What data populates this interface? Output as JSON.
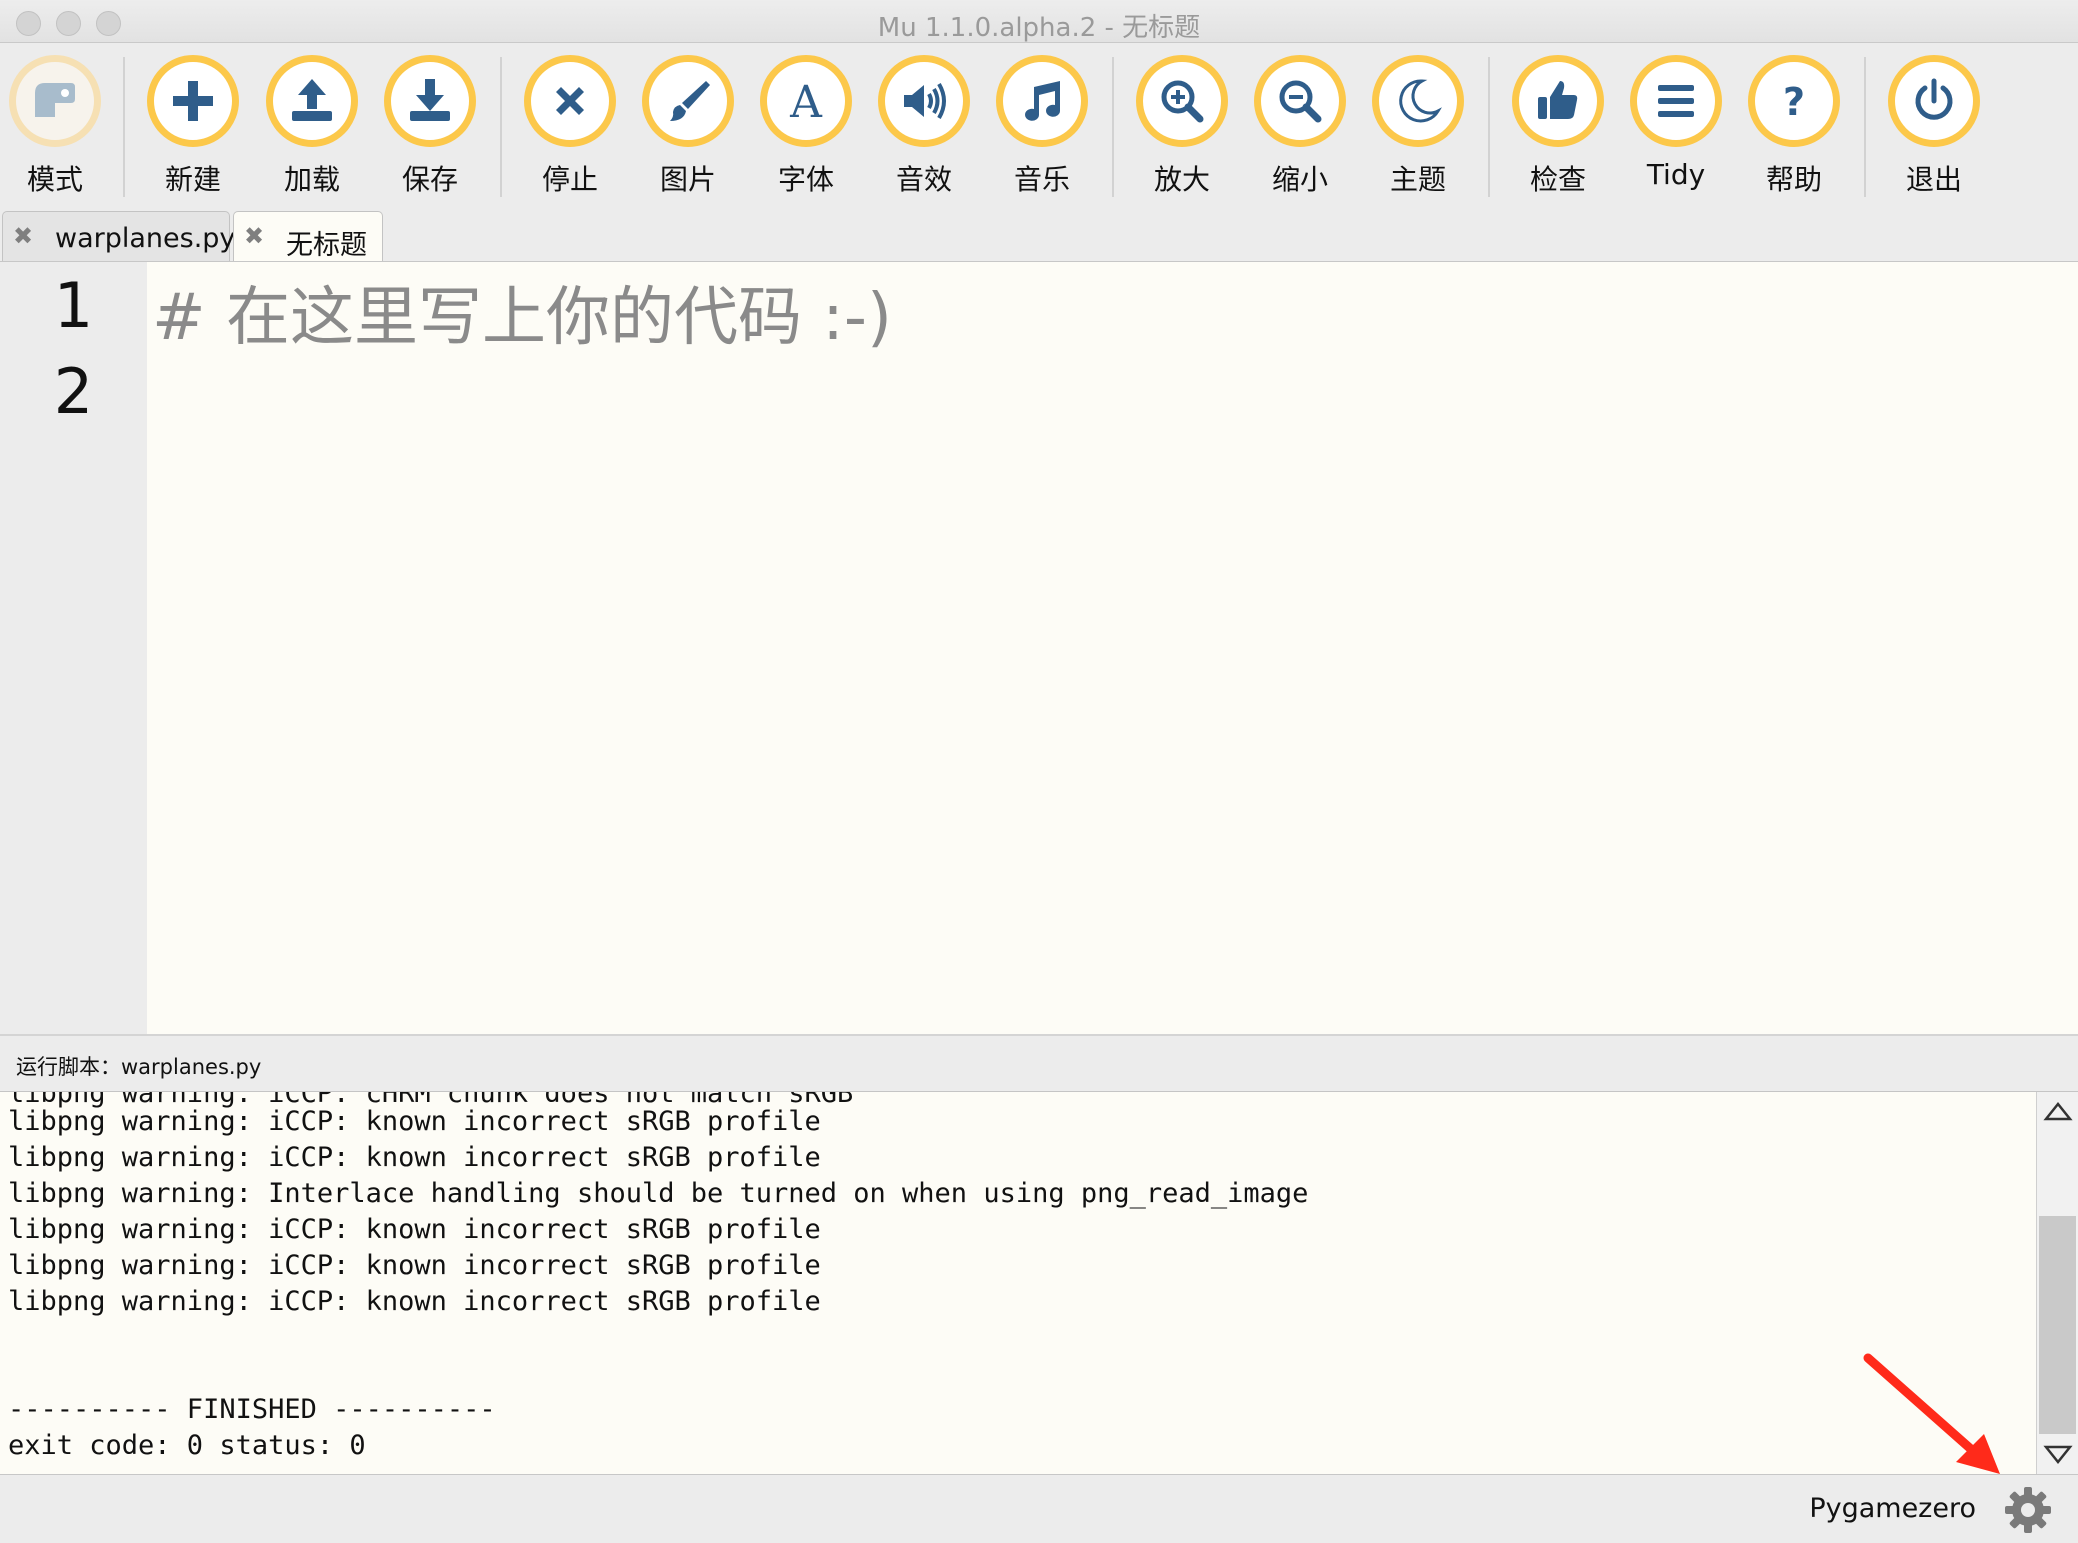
{
  "window": {
    "title": "Mu 1.1.0.alpha.2 - 无标题"
  },
  "toolbar": {
    "buttons": [
      {
        "label": "模式",
        "icon": "mode-icon"
      },
      {
        "label": "新建",
        "icon": "plus-icon"
      },
      {
        "label": "加载",
        "icon": "upload-icon"
      },
      {
        "label": "保存",
        "icon": "download-icon"
      },
      {
        "label": "停止",
        "icon": "close-x-icon"
      },
      {
        "label": "图片",
        "icon": "brush-icon"
      },
      {
        "label": "字体",
        "icon": "font-a-icon"
      },
      {
        "label": "音效",
        "icon": "speaker-icon"
      },
      {
        "label": "音乐",
        "icon": "music-note-icon"
      },
      {
        "label": "放大",
        "icon": "zoom-in-icon"
      },
      {
        "label": "缩小",
        "icon": "zoom-out-icon"
      },
      {
        "label": "主题",
        "icon": "moon-icon"
      },
      {
        "label": "检查",
        "icon": "thumbs-up-icon"
      },
      {
        "label": "Tidy",
        "icon": "lines-icon"
      },
      {
        "label": "帮助",
        "icon": "question-icon"
      },
      {
        "label": "退出",
        "icon": "power-icon"
      }
    ]
  },
  "tabs": [
    {
      "label": "warplanes.py",
      "close": "✖"
    },
    {
      "label": "无标题",
      "close": "✖"
    }
  ],
  "editor": {
    "line_numbers": [
      "1",
      "2"
    ],
    "lines": [
      "#  在这里写上你的代码  :-)",
      ""
    ]
  },
  "runner": {
    "title": "运行脚本：warplanes.py",
    "output": [
      "libpng warning: iCCP: cHRM chunk does not match sRGB",
      "libpng warning: iCCP: known incorrect sRGB profile",
      "libpng warning: iCCP: known incorrect sRGB profile",
      "libpng warning: Interlace handling should be turned on when using png_read_image",
      "libpng warning: iCCP: known incorrect sRGB profile",
      "libpng warning: iCCP: known incorrect sRGB profile",
      "libpng warning: iCCP: known incorrect sRGB profile",
      "",
      "",
      "---------- FINISHED ----------",
      "exit code: 0 status: 0"
    ]
  },
  "status": {
    "mode": "Pygamezero"
  },
  "colors": {
    "accent": "#fcc84a",
    "icon": "#2f5d8a",
    "annotation_arrow": "#ff2a1a"
  }
}
